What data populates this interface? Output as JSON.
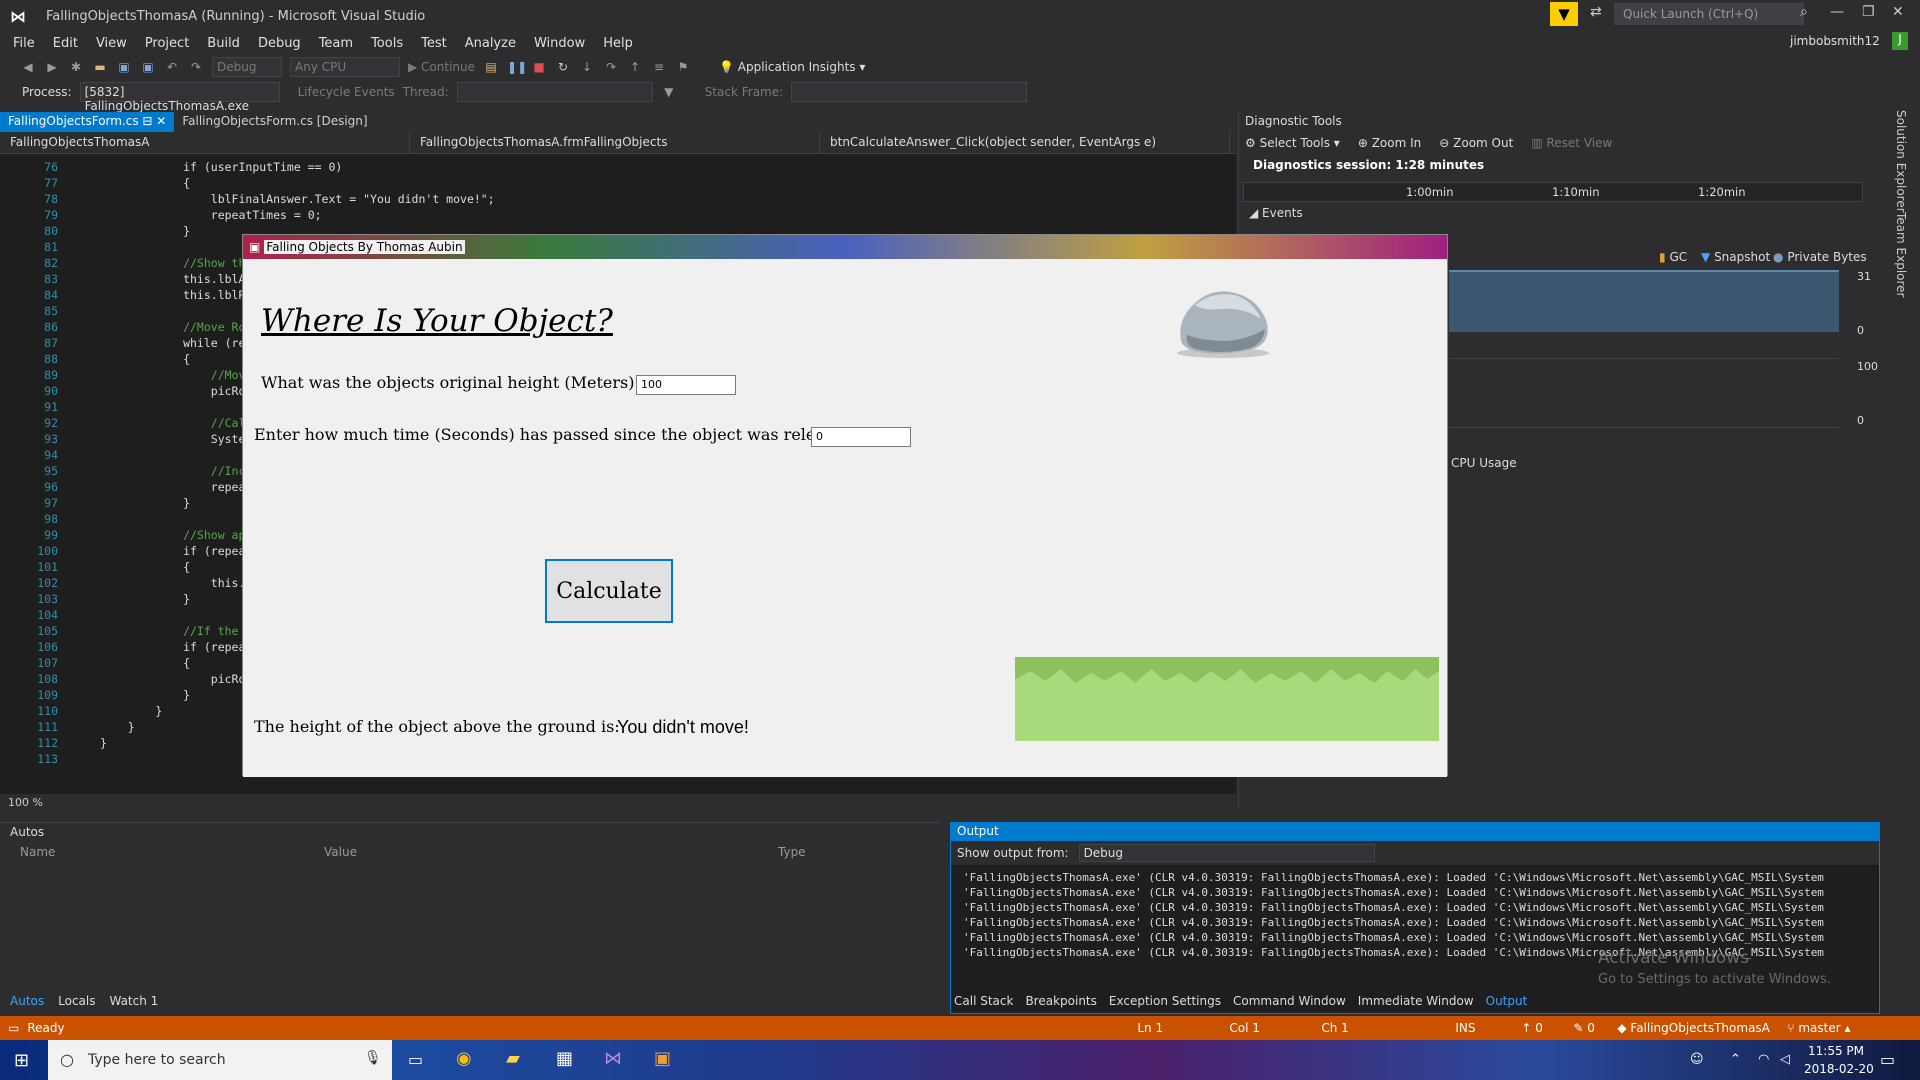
{
  "window": {
    "title": "FallingObjectsThomasA (Running) - Microsoft Visual Studio",
    "quick_launch": "Quick Launch (Ctrl+Q)",
    "user": "jimbobsmith12",
    "user_initial": "J"
  },
  "menu": [
    "File",
    "Edit",
    "View",
    "Project",
    "Build",
    "Debug",
    "Team",
    "Tools",
    "Test",
    "Analyze",
    "Window",
    "Help"
  ],
  "toolbar": {
    "config": "Debug",
    "platform": "Any CPU",
    "continue": "Continue",
    "app_insights": "Application Insights"
  },
  "toolbar2": {
    "process_label": "Process:",
    "process_value": "[5832] FallingObjectsThomasA.exe",
    "lifecycle": "Lifecycle Events",
    "thread_label": "Thread:",
    "stack_label": "Stack Frame:"
  },
  "doc_tabs": [
    "FallingObjectsForm.cs",
    "FallingObjectsForm.cs [Design]"
  ],
  "nav": {
    "project": "FallingObjectsThomasA",
    "class": "FallingObjectsThomasA.frmFallingObjects",
    "member": "btnCalculateAnswer_Click(object sender, EventArgs e)"
  },
  "code_lines": [
    {
      "n": "76",
      "t": "            if (userInputTime == 0)"
    },
    {
      "n": "77",
      "t": "            {"
    },
    {
      "n": "78",
      "t": "                lblFinalAnswer.Text = \"You didn't move!\";"
    },
    {
      "n": "79",
      "t": "                repeatTimes = 0;"
    },
    {
      "n": "80",
      "t": "            }"
    },
    {
      "n": "81",
      "t": ""
    },
    {
      "n": "82",
      "t": "            //Show th"
    },
    {
      "n": "83",
      "t": "            this.lblA"
    },
    {
      "n": "84",
      "t": "            this.lblR"
    },
    {
      "n": "85",
      "t": ""
    },
    {
      "n": "86",
      "t": "            //Move Ro"
    },
    {
      "n": "87",
      "t": "            while (re"
    },
    {
      "n": "88",
      "t": "            {"
    },
    {
      "n": "89",
      "t": "                //Mov"
    },
    {
      "n": "90",
      "t": "                picRo"
    },
    {
      "n": "91",
      "t": ""
    },
    {
      "n": "92",
      "t": "                //Cal"
    },
    {
      "n": "93",
      "t": "                Syste"
    },
    {
      "n": "94",
      "t": ""
    },
    {
      "n": "95",
      "t": "                //Inc"
    },
    {
      "n": "96",
      "t": "                repea"
    },
    {
      "n": "97",
      "t": "            }"
    },
    {
      "n": "98",
      "t": ""
    },
    {
      "n": "99",
      "t": "            //Show ap"
    },
    {
      "n": "100",
      "t": "            if (repea"
    },
    {
      "n": "101",
      "t": "            {"
    },
    {
      "n": "102",
      "t": "                this."
    },
    {
      "n": "103",
      "t": "            }"
    },
    {
      "n": "104",
      "t": ""
    },
    {
      "n": "105",
      "t": "            //If the"
    },
    {
      "n": "106",
      "t": "            if (repea"
    },
    {
      "n": "107",
      "t": "            {"
    },
    {
      "n": "108",
      "t": "                picRo"
    },
    {
      "n": "109",
      "t": "            }"
    },
    {
      "n": "110",
      "t": "        }"
    },
    {
      "n": "111",
      "t": "    }"
    },
    {
      "n": "112",
      "t": "}"
    },
    {
      "n": "113",
      "t": ""
    }
  ],
  "zoom": "100 %",
  "diag": {
    "title": "Diagnostic Tools",
    "select_tools": "Select Tools",
    "zoom_in": "Zoom In",
    "zoom_out": "Zoom Out",
    "reset_view": "Reset View",
    "session": "Diagnostics session: 1:28 minutes",
    "ticks": [
      "1:00min",
      "1:10min",
      "1:20min"
    ],
    "events": "Events",
    "legend": [
      "GC",
      "Snapshot",
      "Private Bytes"
    ],
    "mem_max": "31",
    "mem_min": "0",
    "cpu_max": "100",
    "cpu_min": "0",
    "cpu_label": "CPU Usage"
  },
  "side_tabs": [
    "Solution Explorer",
    "Team Explorer"
  ],
  "autos": {
    "title": "Autos",
    "cols": [
      "Name",
      "Value",
      "Type"
    ],
    "tabs": [
      "Autos",
      "Locals",
      "Watch 1"
    ]
  },
  "output": {
    "title": "Output",
    "show_from": "Show output from:",
    "source": "Debug",
    "lines": [
      "'FallingObjectsThomasA.exe' (CLR v4.0.30319: FallingObjectsThomasA.exe): Loaded 'C:\\Windows\\Microsoft.Net\\assembly\\GAC_MSIL\\System",
      "'FallingObjectsThomasA.exe' (CLR v4.0.30319: FallingObjectsThomasA.exe): Loaded 'C:\\Windows\\Microsoft.Net\\assembly\\GAC_MSIL\\System",
      "'FallingObjectsThomasA.exe' (CLR v4.0.30319: FallingObjectsThomasA.exe): Loaded 'C:\\Windows\\Microsoft.Net\\assembly\\GAC_MSIL\\System",
      "'FallingObjectsThomasA.exe' (CLR v4.0.30319: FallingObjectsThomasA.exe): Loaded 'C:\\Windows\\Microsoft.Net\\assembly\\GAC_MSIL\\System",
      "'FallingObjectsThomasA.exe' (CLR v4.0.30319: FallingObjectsThomasA.exe): Loaded 'C:\\Windows\\Microsoft.Net\\assembly\\GAC_MSIL\\System",
      "'FallingObjectsThomasA.exe' (CLR v4.0.30319: FallingObjectsThomasA.exe): Loaded 'C:\\Windows\\Microsoft.Net\\assembly\\GAC_MSIL\\System"
    ],
    "tabs": [
      "Call Stack",
      "Breakpoints",
      "Exception Settings",
      "Command Window",
      "Immediate Window",
      "Output"
    ],
    "activate1": "Activate Windows",
    "activate2": "Go to Settings to activate Windows."
  },
  "status": {
    "ready": "Ready",
    "ln": "Ln 1",
    "col": "Col 1",
    "ch": "Ch 1",
    "ins": "INS",
    "up": "0",
    "pencil": "0",
    "repo": "FallingObjectsThomasA",
    "branch": "master"
  },
  "taskbar": {
    "search": "Type here to search",
    "time": "11:55 PM",
    "date": "2018-02-20"
  },
  "app": {
    "title": "Falling Objects By Thomas Aubin",
    "heading": "Where Is Your Object?",
    "q1": "What was the objects original height (Meters) ?",
    "q1_value": "100",
    "q2": "Enter how much time (Seconds) has passed since the object was released ?",
    "q2_value": "0",
    "calculate": "Calculate",
    "result_label": "The height of the object above the ground is:",
    "result_value": "You didn't move!"
  }
}
